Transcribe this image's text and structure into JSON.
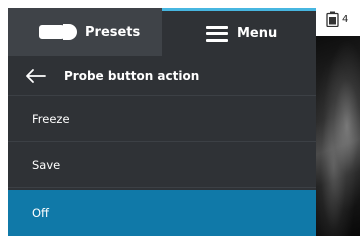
{
  "tabs": {
    "presets_label": "Presets",
    "menu_label": "Menu"
  },
  "header": {
    "title": "Probe button action"
  },
  "options": [
    {
      "label": "Freeze",
      "selected": false
    },
    {
      "label": "Save",
      "selected": false
    },
    {
      "label": "Off",
      "selected": true
    }
  ],
  "status": {
    "battery_text": "4"
  },
  "colors": {
    "panel_bg": "#2f3236",
    "presets_tab_bg": "#3f4348",
    "selected_bg": "#1079a8",
    "accent": "#47b6e0"
  },
  "icons": {
    "presets": "probe-icon",
    "menu": "hamburger-icon",
    "back": "back-arrow-icon",
    "battery": "battery-icon"
  }
}
